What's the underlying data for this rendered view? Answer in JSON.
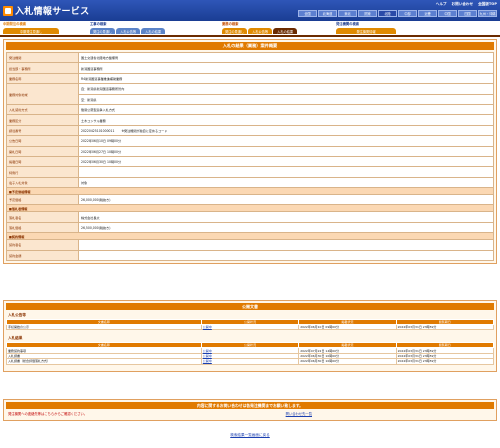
{
  "header": {
    "title": "入札情報サービス",
    "links": [
      "ヘルプ",
      "お問い合わせ",
      "全国版TOP"
    ],
    "regions": [
      "全国",
      "北海道",
      "東北",
      "関東",
      "北陸",
      "中部",
      "近畿",
      "中国",
      "四国",
      "九州・沖縄"
    ],
    "active_region": "北陸"
  },
  "tabs": {
    "groups": [
      {
        "title": "中期発注の検索",
        "tabs": [
          "中期発注見通し"
        ]
      },
      {
        "title": "工事の検索",
        "tabs": [
          "発注の見通し",
          "入札公告等",
          "入札の結果"
        ]
      },
      {
        "title": "業務の検索",
        "tabs": [
          "発注の見通し",
          "入札公告等",
          "入札の結果"
        ]
      },
      {
        "title": "発注機関の検索",
        "tabs": [
          "発注機関情報"
        ]
      }
    ]
  },
  "detail": {
    "heading": "入札の結果（業務）案件概要",
    "rows": [
      {
        "label": "発注機関",
        "value": "国土交通省北陸地方整備局"
      },
      {
        "label": "担当部・事務所",
        "value": "新潟国道事務所"
      },
      {
        "label": "業務名称",
        "value": "R4新潟国道事業推進補助業務"
      },
      {
        "label": "業務対象地域",
        "value": "自：新潟県新潟国道事務所管内",
        "value2": "至：新潟県"
      },
      {
        "label": "入札契約方式",
        "value": "簡易公募型競争入札方式"
      },
      {
        "label": "業務区分",
        "value": "土木コンサル業務"
      },
      {
        "label": "調達番号",
        "value": "20220425101000011",
        "note": "※発注機関が独自に定めるコード"
      },
      {
        "label": "公告日時",
        "value": "2022年06月10日 09時00分"
      },
      {
        "label": "開札日時",
        "value": "2022年06月27日 10時00分"
      },
      {
        "label": "掲載日時",
        "value": "2022年06月30日 10時00分"
      },
      {
        "label": "特例行",
        "value": ""
      },
      {
        "label": "電子入札対象",
        "value": "対象"
      }
    ],
    "section_price": "■予定価格情報",
    "price": {
      "label": "予定価格",
      "value": "26,000,000(税抜き)"
    },
    "section_winner": "■落札者情報",
    "winner": [
      {
        "label": "落札者名",
        "value": "株式会社長大"
      },
      {
        "label": "落札価格",
        "value": "26,500,000(税抜き)"
      }
    ],
    "section_contract": "■契約情報",
    "contract": [
      {
        "label": "契約者名",
        "value": ""
      },
      {
        "label": "契約金額",
        "value": ""
      }
    ]
  },
  "documents": {
    "heading": "公開文書",
    "columns": [
      "文書名称",
      "公開状況",
      "掲載状況",
      "閲覧期日"
    ],
    "sections": [
      {
        "title": "入札公告等",
        "rows": [
          {
            "name": "手続開始の公示",
            "status": "公開中",
            "posted": "2022年06月10日 09時00分",
            "until": "2024年03月31日 23時59分"
          }
        ]
      },
      {
        "title": "入札結果",
        "rows": [
          {
            "name": "業務契約事項",
            "status": "公開中",
            "posted": "2022年07月22日 14時00分",
            "until": "2024年03月31日 23時59分"
          },
          {
            "name": "入札調書",
            "status": "公開中",
            "posted": "2022年06月30日 10時00分",
            "until": "2024年03月31日 23時59分"
          },
          {
            "name": "入札調書（総合評価落札方式）",
            "status": "公開中",
            "posted": "2022年06月30日 10時00分",
            "until": "2024年03月31日 23時59分"
          }
        ]
      }
    ]
  },
  "inquiry": {
    "heading": "内容に関するお問い合わせは各発注機関までお願い致します。",
    "text": "発注機関への連絡先等はこちらからご確認ください。",
    "link": "問い合わせ先一覧"
  },
  "back_link": "検索結果一覧画面に戻る"
}
